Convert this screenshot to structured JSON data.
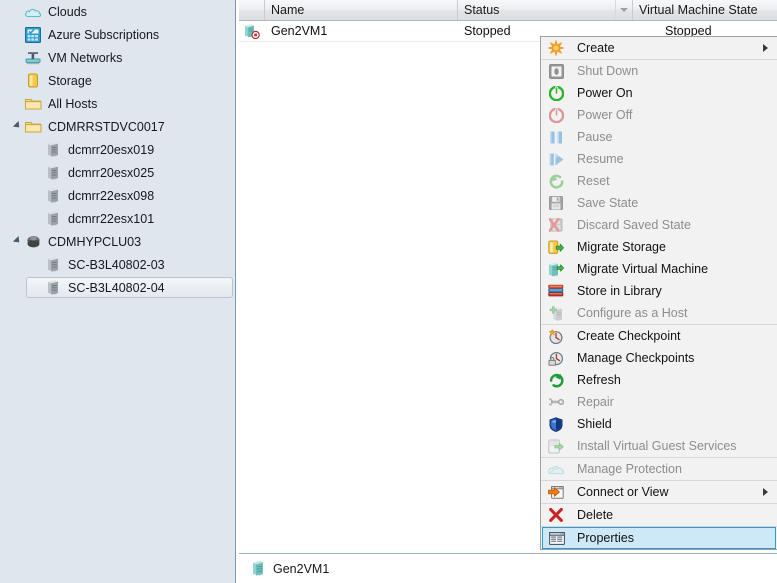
{
  "sidebar": {
    "items": [
      {
        "label": "Clouds",
        "icon": "cloud-icon",
        "level": 0,
        "twisty": "none",
        "selected": false
      },
      {
        "label": "Azure Subscriptions",
        "icon": "azure-icon",
        "level": 0,
        "twisty": "none",
        "selected": false
      },
      {
        "label": "VM Networks",
        "icon": "vm-network-icon",
        "level": 0,
        "twisty": "none",
        "selected": false
      },
      {
        "label": "Storage",
        "icon": "storage-icon",
        "level": 0,
        "twisty": "none",
        "selected": false
      },
      {
        "label": "All Hosts",
        "icon": "folder-icon",
        "level": 0,
        "twisty": "none",
        "selected": false
      },
      {
        "label": "CDMRRSTDVC0017",
        "icon": "folder-icon",
        "level": 0,
        "twisty": "expanded",
        "selected": false
      },
      {
        "label": "dcmrr20esx019",
        "icon": "host-icon",
        "level": 1,
        "twisty": "none",
        "selected": false
      },
      {
        "label": "dcmrr20esx025",
        "icon": "host-icon",
        "level": 1,
        "twisty": "none",
        "selected": false
      },
      {
        "label": "dcmrr22esx098",
        "icon": "host-icon",
        "level": 1,
        "twisty": "none",
        "selected": false
      },
      {
        "label": "dcmrr22esx101",
        "icon": "host-icon",
        "level": 1,
        "twisty": "none",
        "selected": false
      },
      {
        "label": "CDMHYPCLU03",
        "icon": "cluster-icon",
        "level": 0,
        "twisty": "expanded",
        "selected": false
      },
      {
        "label": "SC-B3L40802-03",
        "icon": "host-icon",
        "level": 1,
        "twisty": "none",
        "selected": false
      },
      {
        "label": "SC-B3L40802-04",
        "icon": "host-icon",
        "level": 1,
        "twisty": "none",
        "selected": true
      }
    ]
  },
  "list_view": {
    "columns": [
      {
        "label": "",
        "key": "icon"
      },
      {
        "label": "Name",
        "key": "name"
      },
      {
        "label": "Status",
        "key": "status"
      },
      {
        "label": "Virtual Machine State",
        "key": "vm_state"
      }
    ],
    "sort_button": "column-options-dropdown",
    "rows": [
      {
        "icon": "vm-stopped-icon",
        "name": "Gen2VM1",
        "status": "Stopped",
        "vm_state": "Stopped"
      }
    ]
  },
  "detail_pane": {
    "icon": "vm-icon",
    "title": "Gen2VM1"
  },
  "context_menu": {
    "items": [
      {
        "label": "Create",
        "icon": "create-star-icon",
        "disabled": false,
        "submenu": true,
        "highlight": false,
        "separator_after": true
      },
      {
        "label": "Shut Down",
        "icon": "shut-down-icon",
        "disabled": true,
        "submenu": false,
        "highlight": false,
        "separator_after": false
      },
      {
        "label": "Power On",
        "icon": "power-on-icon",
        "disabled": false,
        "submenu": false,
        "highlight": false,
        "separator_after": false
      },
      {
        "label": "Power Off",
        "icon": "power-off-icon",
        "disabled": true,
        "submenu": false,
        "highlight": false,
        "separator_after": false
      },
      {
        "label": "Pause",
        "icon": "pause-icon",
        "disabled": true,
        "submenu": false,
        "highlight": false,
        "separator_after": false
      },
      {
        "label": "Resume",
        "icon": "resume-icon",
        "disabled": true,
        "submenu": false,
        "highlight": false,
        "separator_after": false
      },
      {
        "label": "Reset",
        "icon": "reset-icon",
        "disabled": true,
        "submenu": false,
        "highlight": false,
        "separator_after": false
      },
      {
        "label": "Save State",
        "icon": "save-state-icon",
        "disabled": true,
        "submenu": false,
        "highlight": false,
        "separator_after": false
      },
      {
        "label": "Discard Saved State",
        "icon": "discard-state-icon",
        "disabled": true,
        "submenu": false,
        "highlight": false,
        "separator_after": false
      },
      {
        "label": "Migrate Storage",
        "icon": "migrate-storage-icon",
        "disabled": false,
        "submenu": false,
        "highlight": false,
        "separator_after": false
      },
      {
        "label": "Migrate Virtual Machine",
        "icon": "migrate-vm-icon",
        "disabled": false,
        "submenu": false,
        "highlight": false,
        "separator_after": false
      },
      {
        "label": "Store in Library",
        "icon": "store-library-icon",
        "disabled": false,
        "submenu": false,
        "highlight": false,
        "separator_after": false
      },
      {
        "label": "Configure as a Host",
        "icon": "configure-host-icon",
        "disabled": true,
        "submenu": false,
        "highlight": false,
        "separator_after": true
      },
      {
        "label": "Create Checkpoint",
        "icon": "create-checkpoint-icon",
        "disabled": false,
        "submenu": false,
        "highlight": false,
        "separator_after": false
      },
      {
        "label": "Manage Checkpoints",
        "icon": "manage-checkpoints-icon",
        "disabled": false,
        "submenu": false,
        "highlight": false,
        "separator_after": false
      },
      {
        "label": "Refresh",
        "icon": "refresh-icon",
        "disabled": false,
        "submenu": false,
        "highlight": false,
        "separator_after": false
      },
      {
        "label": "Repair",
        "icon": "repair-wrench-icon",
        "disabled": true,
        "submenu": false,
        "highlight": false,
        "separator_after": false
      },
      {
        "label": "Shield",
        "icon": "shield-icon",
        "disabled": false,
        "submenu": false,
        "highlight": false,
        "separator_after": false
      },
      {
        "label": "Install Virtual Guest Services",
        "icon": "install-guest-svc-icon",
        "disabled": true,
        "submenu": false,
        "highlight": false,
        "separator_after": true
      },
      {
        "label": "Manage Protection",
        "icon": "manage-protection-icon",
        "disabled": true,
        "submenu": false,
        "highlight": false,
        "separator_after": true
      },
      {
        "label": "Connect or View",
        "icon": "connect-view-icon",
        "disabled": false,
        "submenu": true,
        "highlight": false,
        "separator_after": true
      },
      {
        "label": "Delete",
        "icon": "delete-x-icon",
        "disabled": false,
        "submenu": false,
        "highlight": false,
        "separator_after": true
      },
      {
        "label": "Properties",
        "icon": "properties-icon",
        "disabled": false,
        "submenu": false,
        "highlight": true,
        "separator_after": false
      }
    ]
  },
  "colors": {
    "sidebar_bg": "#dfe6ee",
    "menu_bg": "#f2f2f2",
    "highlight_bg": "#cde8f7",
    "highlight_border": "#3399cc",
    "disabled_text": "#8d8d8d"
  }
}
